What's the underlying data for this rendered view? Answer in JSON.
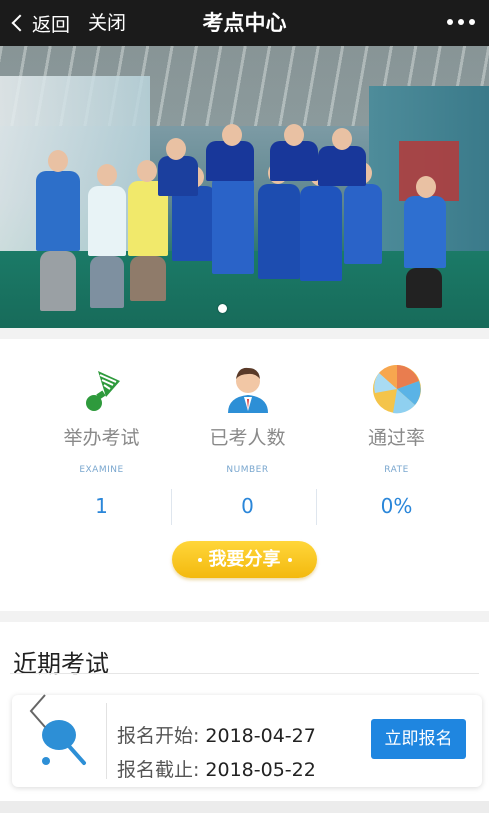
{
  "nav": {
    "back_label": "返回",
    "close_label": "关闭",
    "title": "考点中心",
    "more_icon": "more-dots-icon"
  },
  "banner": {
    "slide_count": 1,
    "active_slide": 1
  },
  "stats": [
    {
      "label": "举办考试",
      "label_en": "EXAMINE",
      "value": "1",
      "icon": "shuttlecock-icon"
    },
    {
      "label": "已考人数",
      "label_en": "NUMBER",
      "value": "0",
      "icon": "person-avatar-icon"
    },
    {
      "label": "通过率",
      "label_en": "RATE",
      "value": "0%",
      "icon": "pie-chart-icon"
    }
  ],
  "share_button": {
    "label": "我要分享"
  },
  "recent_exams": {
    "title": "近期考试",
    "items": [
      {
        "start_label": "报名开始:",
        "start_date": "2018-04-27",
        "end_label": "报名截止:",
        "end_date": "2018-05-22",
        "action_label": "立即报名",
        "icon": "racket-icon"
      }
    ]
  },
  "colors": {
    "nav_bg": "#1b1b1b",
    "accent_blue": "#1f86e0",
    "stat_value": "#2a86d9",
    "share_yellow": "#f7c623",
    "shuttlecock_green": "#2e9a3c"
  }
}
